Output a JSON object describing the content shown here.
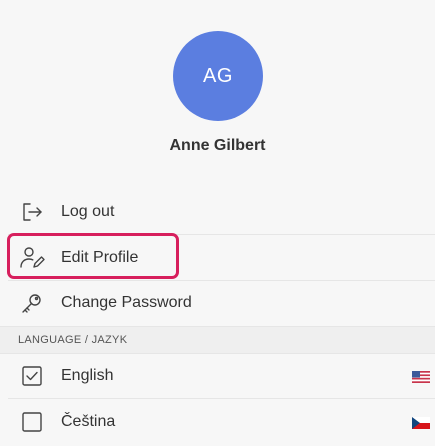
{
  "profile": {
    "initials": "AG",
    "name": "Anne Gilbert",
    "avatar_color": "#5b7ee0"
  },
  "menu": {
    "logout": {
      "label": "Log out",
      "icon": "logout-icon"
    },
    "edit_profile": {
      "label": "Edit Profile",
      "icon": "user-edit-icon",
      "highlighted": true
    },
    "change_password": {
      "label": "Change Password",
      "icon": "key-icon"
    }
  },
  "language": {
    "header": "LANGUAGE / JAZYK",
    "options": [
      {
        "label": "English",
        "checked": true,
        "flag": "us-flag-icon"
      },
      {
        "label": "Čeština",
        "checked": false,
        "flag": "cz-flag-icon"
      }
    ]
  },
  "colors": {
    "highlight": "#d71f5d",
    "text": "#333333",
    "background": "#f7f7f7"
  }
}
